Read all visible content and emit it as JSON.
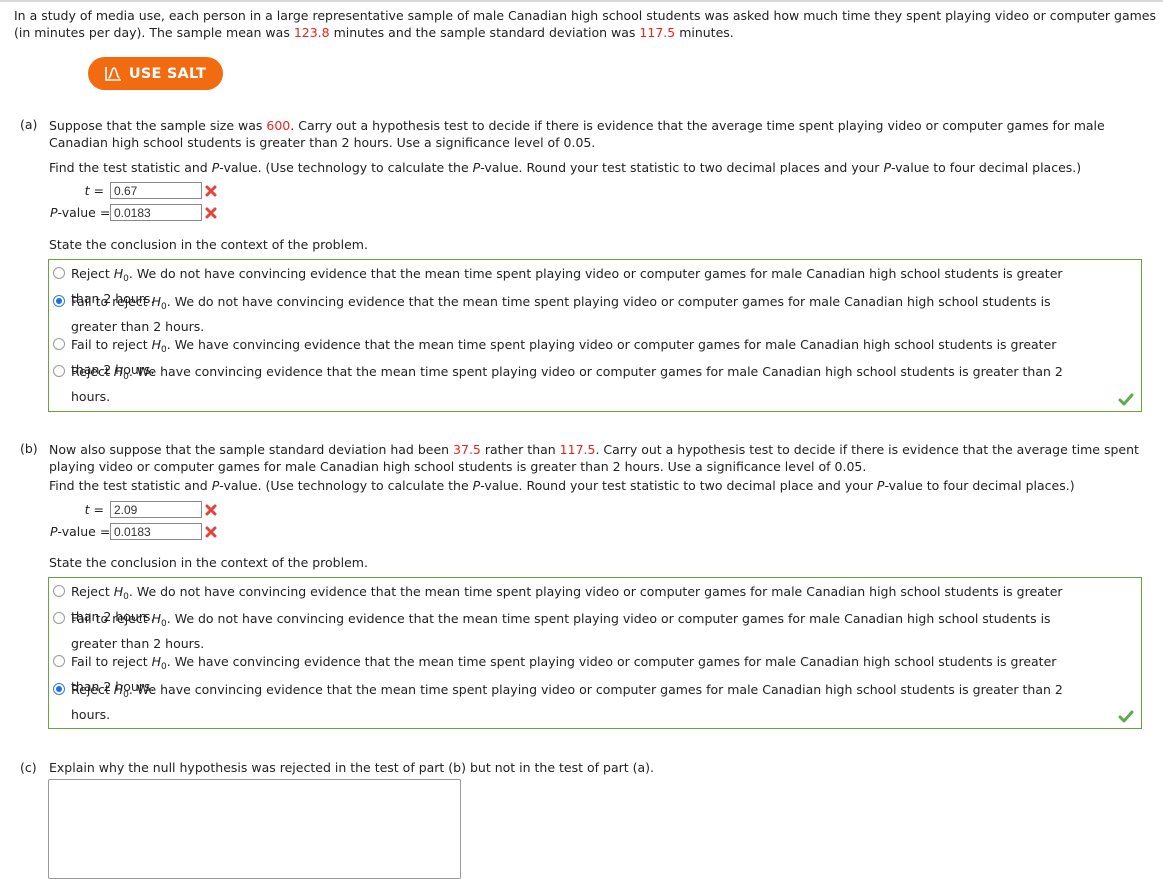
{
  "intro": {
    "text_1": "In a study of media use, each person in a large representative sample of male Canadian high school students was asked how much time they spent playing video or computer games (in minutes per day). The sample mean was ",
    "mean": "123.8",
    "text_2": " minutes and the sample standard deviation was ",
    "sd": "117.5",
    "text_3": " minutes."
  },
  "salt_button": {
    "label": "USE SALT",
    "color": "#f26b10"
  },
  "part_a": {
    "label": "(a)",
    "text_1": "Suppose that the sample size was ",
    "n": "600",
    "text_2": ". Carry out a hypothesis test to decide if there is evidence that the average time spent playing video or computer games for male Canadian high school students is greater than 2 hours. Use a significance level of 0.05.",
    "instruction_1": "Find the test statistic and ",
    "instruction_p": "P",
    "instruction_2": "-value. (Use technology to calculate the ",
    "instruction_3": "-value. Round your test statistic to two decimal places and your ",
    "instruction_4": "-value to four decimal places.)",
    "t_label": "t",
    "t_value": "0.67",
    "p_label_italic": "P",
    "p_label_rest": "-value",
    "p_value": "0.0183",
    "t_status": "incorrect",
    "p_status": "incorrect",
    "conclusion_prompt": "State the conclusion in the context of the problem.",
    "options": [
      {
        "lead": "Reject ",
        "rest": ". We do not have convincing evidence that the mean time spent playing video or computer games for male Canadian high school students is greater than 2 hours.",
        "selected": false
      },
      {
        "lead": "Fail to reject ",
        "rest": ". We do not have convincing evidence that the mean time spent playing video or computer games for male Canadian high school students is greater than 2 hours.",
        "selected": true
      },
      {
        "lead": "Fail to reject ",
        "rest": ". We have convincing evidence that the mean time spent playing video or computer games for male Canadian high school students is greater than 2 hours.",
        "selected": false
      },
      {
        "lead": "Reject ",
        "rest": ". We have convincing evidence that the mean time spent playing video or computer games for male Canadian high school students is greater than 2 hours.",
        "selected": false
      }
    ],
    "conclusion_status": "correct"
  },
  "part_b": {
    "label": "(b)",
    "text_1": "Now also suppose that the sample standard deviation had been ",
    "new_sd": "37.5",
    "text_2": " rather than ",
    "old_sd": "117.5",
    "text_3": ". Carry out a hypothesis test to decide if there is evidence that the average time spent playing video or computer games for male Canadian high school students is greater than 2 hours. Use a significance level of 0.05.",
    "instruction_1": "Find the test statistic and ",
    "instruction_p": "P",
    "instruction_2": "-value. (Use technology to calculate the ",
    "instruction_3": "-value. Round your test statistic to two decimal place and your ",
    "instruction_4": "-value to four decimal places.)",
    "t_label": "t",
    "t_value": "2.09",
    "p_label_italic": "P",
    "p_label_rest": "-value",
    "p_value": "0.0183",
    "t_status": "incorrect",
    "p_status": "incorrect",
    "conclusion_prompt": "State the conclusion in the context of the problem.",
    "options": [
      {
        "lead": "Reject ",
        "rest": ". We do not have convincing evidence that the mean time spent playing video or computer games for male Canadian high school students is greater than 2 hours.",
        "selected": false
      },
      {
        "lead": "Fail to reject ",
        "rest": ". We do not have convincing evidence that the mean time spent playing video or computer games for male Canadian high school students is greater than 2 hours.",
        "selected": false
      },
      {
        "lead": "Fail to reject ",
        "rest": ". We have convincing evidence that the mean time spent playing video or computer games for male Canadian high school students is greater than 2 hours.",
        "selected": false
      },
      {
        "lead": "Reject ",
        "rest": ". We have convincing evidence that the mean time spent playing video or computer games for male Canadian high school students is greater than 2 hours.",
        "selected": true
      }
    ],
    "conclusion_status": "correct"
  },
  "part_c": {
    "label": "(c)",
    "question": "Explain why the null hypothesis was rejected in the test of part (b) but not in the test of part (a).",
    "answer": ""
  },
  "symbols": {
    "h": "H",
    "h_sub": "0",
    "equals": "="
  },
  "colors": {
    "highlight_red": "#e8251f",
    "correct_green": "#6aa23b",
    "incorrect_red": "#e0443a",
    "radio_blue": "#1f6fe0"
  }
}
